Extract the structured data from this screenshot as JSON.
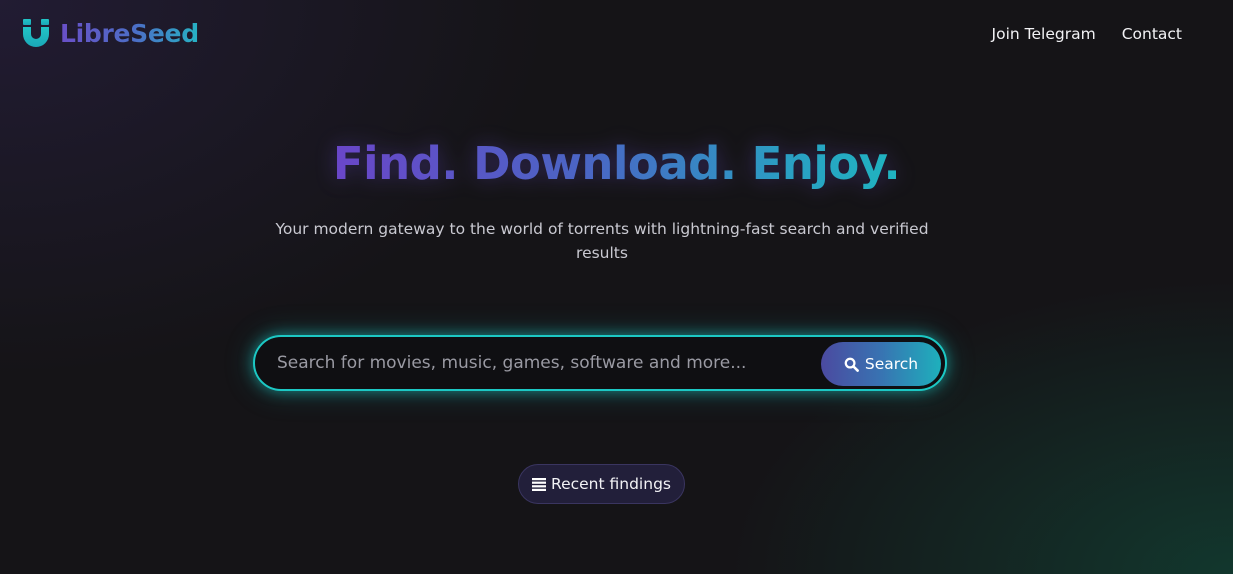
{
  "brand": {
    "name": "LibreSeed",
    "icon": "magnet-icon",
    "gradient_start": "#6a4fc7",
    "gradient_end": "#26b3c4"
  },
  "nav": {
    "links": [
      {
        "label": "Join Telegram"
      },
      {
        "label": "Contact"
      }
    ]
  },
  "hero": {
    "title": "Find. Download. Enjoy.",
    "subtitle": "Your modern gateway to the world of torrents with lightning-fast search and verified results"
  },
  "search": {
    "value": "",
    "placeholder": "Search for movies, music, games, software and more...",
    "button_label": "Search",
    "button_icon": "search-icon",
    "accent": "#1cc8c4"
  },
  "recent": {
    "label": "Recent findings",
    "icon": "list-icon"
  }
}
